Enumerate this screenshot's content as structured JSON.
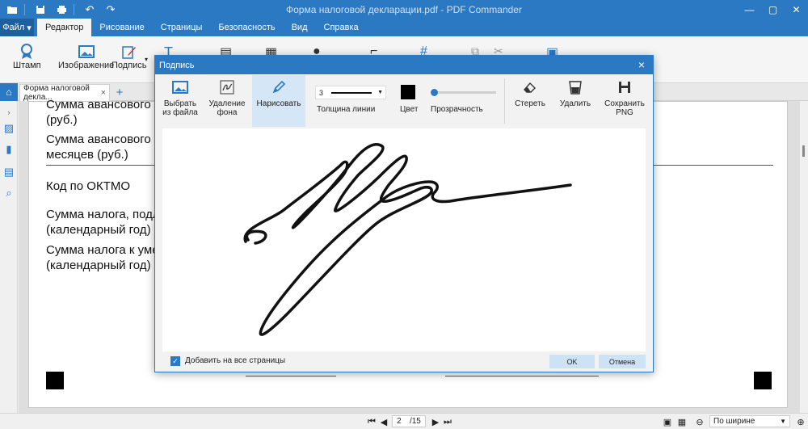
{
  "app": {
    "title": "Форма налоговой декларации.pdf - PDF Commander"
  },
  "menu": {
    "file": "Файл",
    "tabs": [
      "Редактор",
      "Рисование",
      "Страницы",
      "Безопасность",
      "Вид",
      "Справка"
    ],
    "active_tab": "Редактор"
  },
  "ribbon": {
    "stamp": "Штамп",
    "image": "Изображение",
    "signature": "Подпись"
  },
  "doc_tab": {
    "label": "Форма налоговой декла...",
    "close": "×",
    "add": "+"
  },
  "document": {
    "lines": [
      "Сумма авансового п",
      "(руб.)",
      "Сумма авансового п",
      "месяцев (руб.)",
      "Код по ОКТМО",
      "Сумма налога, подл",
      "(календарный год) (р",
      "Сумма налога к умен",
      "(календарный год) (р"
    ]
  },
  "dialog": {
    "title": "Подпись",
    "close": "×",
    "toolbar": {
      "from_file": "Выбрать из файла",
      "remove_bg": "Удаление фона",
      "draw": "Нарисовать",
      "line_width_value": "3",
      "line_width_label": "Толщина линии",
      "color_label": "Цвет",
      "color_value": "#000000",
      "opacity_label": "Прозрачность",
      "opacity_value": 0,
      "erase": "Стереть",
      "delete": "Удалить",
      "save_png": "Сохранить PNG"
    },
    "footer": {
      "apply_all": "Добавить на все страницы",
      "apply_all_checked": true,
      "ok": "OK",
      "cancel": "Отмена"
    }
  },
  "status": {
    "page_current": "2",
    "page_total": "/15",
    "zoom": "По ширине"
  },
  "colors": {
    "accent": "#2b79c2",
    "active_tool": "#d5e6f6",
    "button": "#cde2f5"
  }
}
